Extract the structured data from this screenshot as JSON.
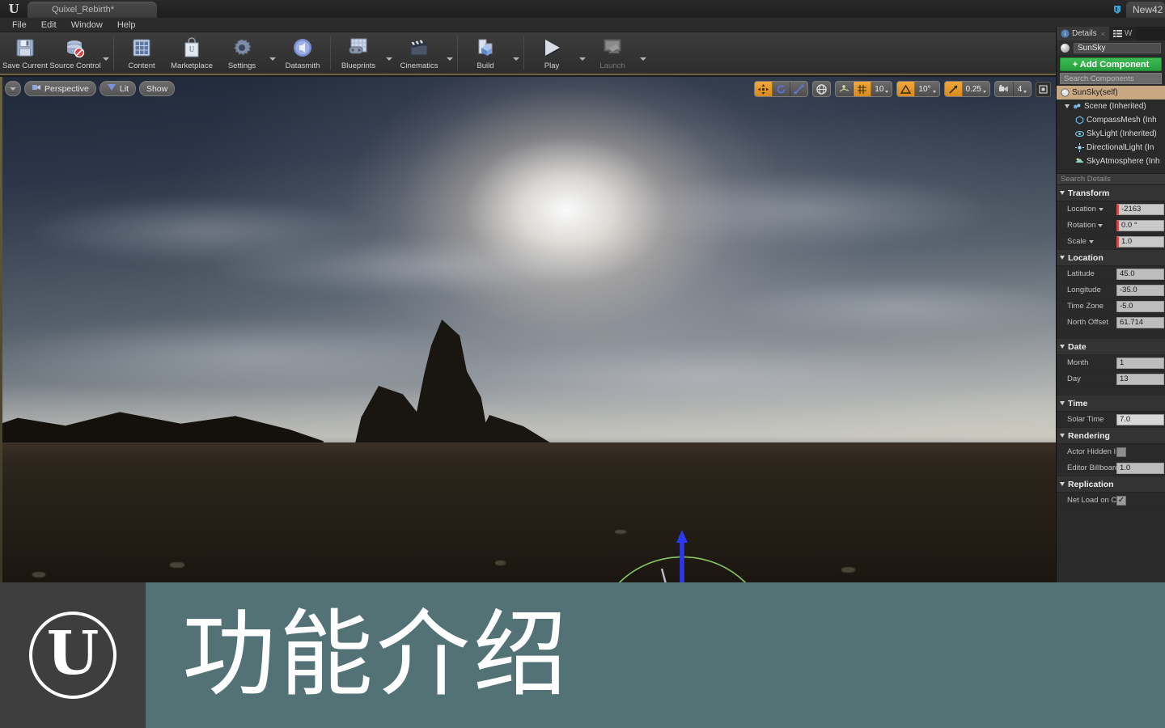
{
  "window": {
    "project_tab": "Quixel_Rebirth*",
    "right_tab": "New42",
    "logo_glyph": "U"
  },
  "menubar": {
    "items": [
      "File",
      "Edit",
      "Window",
      "Help"
    ]
  },
  "toolbar": {
    "groups": [
      {
        "buttons": [
          {
            "label": "Save Current",
            "icon": "save-disk-icon",
            "has_arrow": false,
            "dim": false
          },
          {
            "label": "Source Control",
            "icon": "source-control-icon",
            "has_arrow": true,
            "dim": false
          }
        ]
      },
      {
        "buttons": [
          {
            "label": "Content",
            "icon": "content-browser-icon",
            "has_arrow": false,
            "dim": false
          },
          {
            "label": "Marketplace",
            "icon": "marketplace-bag-icon",
            "has_arrow": false,
            "dim": false
          },
          {
            "label": "Settings",
            "icon": "settings-gear-icon",
            "has_arrow": true,
            "dim": false
          },
          {
            "label": "Datasmith",
            "icon": "datasmith-icon",
            "has_arrow": false,
            "dim": false
          }
        ]
      },
      {
        "buttons": [
          {
            "label": "Blueprints",
            "icon": "blueprints-icon",
            "has_arrow": true,
            "dim": false
          },
          {
            "label": "Cinematics",
            "icon": "cinematics-clapper-icon",
            "has_arrow": true,
            "dim": false
          }
        ]
      },
      {
        "buttons": [
          {
            "label": "Build",
            "icon": "build-icon",
            "has_arrow": true,
            "dim": false
          }
        ]
      },
      {
        "buttons": [
          {
            "label": "Play",
            "icon": "play-triangle-icon",
            "has_arrow": true,
            "dim": false
          },
          {
            "label": "Launch",
            "icon": "launch-icon",
            "has_arrow": true,
            "dim": true
          }
        ]
      }
    ]
  },
  "viewport": {
    "left_controls": [
      {
        "name": "viewport-options",
        "label": "",
        "icon": "chevron-down-icon"
      },
      {
        "name": "camera-mode",
        "label": "Perspective",
        "icon": "camera-icon"
      },
      {
        "name": "view-mode",
        "label": "Lit",
        "icon": "lit-shading-icon"
      },
      {
        "name": "show-menu",
        "label": "Show",
        "icon": ""
      }
    ],
    "snap_bar": {
      "transform_group": [
        {
          "name": "select-translate-mode",
          "icon": "move-gizmo-icon",
          "active": true
        },
        {
          "name": "rotate-mode",
          "icon": "rotate-gizmo-icon",
          "active": false
        },
        {
          "name": "scale-mode",
          "icon": "scale-gizmo-icon",
          "active": false
        }
      ],
      "coord_group": [
        {
          "name": "world-space-toggle",
          "icon": "globe-icon",
          "active": false
        }
      ],
      "grid_group": [
        {
          "name": "surface-snap-toggle",
          "icon": "surface-snap-icon",
          "active": false
        },
        {
          "name": "grid-snap-toggle",
          "icon": "grid-icon",
          "active": true
        },
        {
          "name": "grid-snap-value",
          "value": "10",
          "active": false
        }
      ],
      "rotation_group": [
        {
          "name": "rotation-snap-toggle",
          "icon": "angle-icon",
          "active": true
        },
        {
          "name": "rotation-snap-value",
          "value": "10°",
          "active": false
        }
      ],
      "scale_group": [
        {
          "name": "scale-snap-toggle",
          "icon": "scale-snap-icon",
          "active": true
        },
        {
          "name": "scale-snap-value",
          "value": "0.25",
          "active": false
        }
      ],
      "camera_group": [
        {
          "name": "camera-speed-icon",
          "icon": "camera-speed-icon",
          "active": false
        },
        {
          "name": "camera-speed-value",
          "value": "4",
          "active": false
        }
      ],
      "maximize": {
        "name": "maximize-viewport-button",
        "icon": "maximize-icon"
      }
    },
    "gizmo": {
      "type": "sunsky-compass-gizmo",
      "axis_x_color": "#e02020",
      "axis_y_color": "#22e022",
      "axis_z_color": "#2a38f0",
      "ring_color": "#8a8af5",
      "sun_path_color": "#8fcf6a"
    }
  },
  "details_panel": {
    "tabs": [
      {
        "label": "Details",
        "icon": "details-info-icon",
        "active": true
      },
      {
        "label": "W",
        "icon": "world-outliner-icon",
        "active": false
      }
    ],
    "actor_name": "SunSky",
    "add_component_label": "+ Add Component",
    "add_component_color": "#2fae45",
    "search_components_placeholder": "Search Components",
    "component_tree": [
      {
        "label": "SunSky(self)",
        "icon": "sphere-icon",
        "indent": 0,
        "selected": true,
        "expander": ""
      },
      {
        "label": "Scene (Inherited)",
        "icon": "scene-icon",
        "indent": 1,
        "selected": false,
        "expander": "down"
      },
      {
        "label": "CompassMesh (Inh",
        "icon": "mesh-icon",
        "indent": 2,
        "selected": false,
        "expander": ""
      },
      {
        "label": "SkyLight (Inherited)",
        "icon": "skylight-icon",
        "indent": 2,
        "selected": false,
        "expander": ""
      },
      {
        "label": "DirectionalLight (In",
        "icon": "directional-light-icon",
        "indent": 2,
        "selected": false,
        "expander": ""
      },
      {
        "label": "SkyAtmosphere (Inh",
        "icon": "sky-atmosphere-icon",
        "indent": 2,
        "selected": false,
        "expander": ""
      }
    ],
    "search_details_placeholder": "Search Details",
    "sections": [
      {
        "title": "Transform",
        "rows": [
          {
            "name": "Location",
            "value": "-2163",
            "type": "vector",
            "has_dropdown": true
          },
          {
            "name": "Rotation",
            "value": "0.0 °",
            "type": "vector",
            "has_dropdown": true
          },
          {
            "name": "Scale",
            "value": "1.0",
            "type": "vector",
            "has_dropdown": true
          }
        ]
      },
      {
        "title": "Location",
        "rows": [
          {
            "name": "Latitude",
            "value": "45.0",
            "type": "number",
            "has_dropdown": false
          },
          {
            "name": "Longitude",
            "value": "-35.0",
            "type": "number",
            "has_dropdown": false
          },
          {
            "name": "Time Zone",
            "value": "-5.0",
            "type": "number",
            "has_dropdown": false
          },
          {
            "name": "North Offset",
            "value": "61.714",
            "type": "number",
            "has_dropdown": false
          }
        ]
      },
      {
        "title": "Date",
        "rows": [
          {
            "name": "Month",
            "value": "1",
            "type": "number",
            "has_dropdown": false
          },
          {
            "name": "Day",
            "value": "13",
            "type": "number",
            "has_dropdown": false
          }
        ]
      },
      {
        "title": "Time",
        "rows": [
          {
            "name": "Solar Time",
            "value": "7.0",
            "type": "number",
            "has_dropdown": false
          }
        ]
      },
      {
        "title": "Rendering",
        "rows": [
          {
            "name": "Actor Hidden In Gan",
            "value": "",
            "type": "checkbox",
            "checked": false
          },
          {
            "name": "Editor Billboard Sca",
            "value": "1.0",
            "type": "number",
            "has_dropdown": false
          }
        ]
      },
      {
        "title": "Replication",
        "rows": [
          {
            "name": "Net Load on Client",
            "value": "",
            "type": "checkbox",
            "checked": true
          }
        ]
      }
    ]
  },
  "banner": {
    "title": "功能介绍",
    "logo_glyph": "U",
    "background_color": "#527275",
    "logo_background": "#3e3e3e"
  }
}
